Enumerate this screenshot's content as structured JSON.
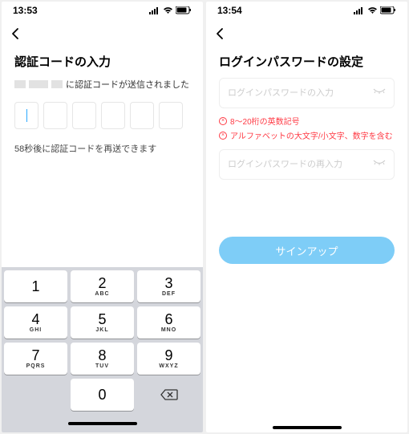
{
  "left": {
    "status": {
      "time": "13:53"
    },
    "title": "認証コードの入力",
    "sent_suffix": "に認証コードが送信されました",
    "resend": "58秒後に認証コードを再送できます",
    "keypad": {
      "rows": [
        [
          {
            "d": "1",
            "l": ""
          },
          {
            "d": "2",
            "l": "ABC"
          },
          {
            "d": "3",
            "l": "DEF"
          }
        ],
        [
          {
            "d": "4",
            "l": "GHI"
          },
          {
            "d": "5",
            "l": "JKL"
          },
          {
            "d": "6",
            "l": "MNO"
          }
        ],
        [
          {
            "d": "7",
            "l": "PQRS"
          },
          {
            "d": "8",
            "l": "TUV"
          },
          {
            "d": "9",
            "l": "WXYZ"
          }
        ],
        [
          {
            "blank": true
          },
          {
            "d": "0",
            "l": ""
          },
          {
            "del": true
          }
        ]
      ]
    }
  },
  "right": {
    "status": {
      "time": "13:54"
    },
    "title": "ログインパスワードの設定",
    "password_placeholder": "ログインパスワードの入力",
    "confirm_placeholder": "ログインパスワードの再入力",
    "rules": [
      "8〜20桁の英数記号",
      "アルファベットの大文字/小文字、数字を含む"
    ],
    "signup_label": "サインアップ"
  }
}
